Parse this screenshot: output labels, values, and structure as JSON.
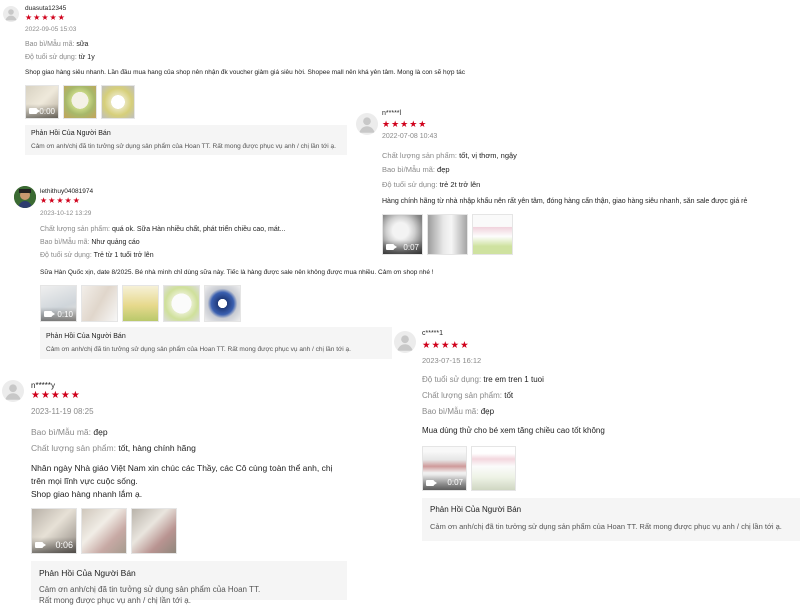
{
  "reviews": [
    {
      "username": "duasuta12345",
      "stars": "★★★★★",
      "date": "2022-09-05 15:03",
      "attrs": [
        {
          "label": "Bao bì/Mẫu mã:",
          "value": "sữa"
        },
        {
          "label": "Độ tuổi sử dụng:",
          "value": "từ 1y"
        }
      ],
      "content": "Shop giao hàng siêu nhanh. Lần đầu mua hang của shop nên nhận đk voucher giảm giá siêu hời. Shopee mall nên khá yên tâm. Mong là con sẽ hợp tác",
      "media": [
        {
          "duration": "0:00"
        },
        {},
        {}
      ],
      "reply_title": "Phản Hồi Của Người Bán",
      "reply_text": "Cảm ơn anh/chị đã tin tưởng sử dụng sản phẩm của Hoan TT. Rất mong được phục vụ anh / chị lần tới ạ."
    },
    {
      "username": "n*****l",
      "stars": "★★★★★",
      "date": "2022-07-08 10:43",
      "attrs": [
        {
          "label": "Chất lượng sản phẩm:",
          "value": "tốt, vị thơm, ngậy"
        },
        {
          "label": "Bao bì/Mẫu mã:",
          "value": "đẹp"
        },
        {
          "label": "Độ tuổi sử dụng:",
          "value": "trẻ 2t trở lên"
        }
      ],
      "content": "Hàng chính hãng từ nhà nhập khẩu nên rất yên tâm, đóng hàng cẩn thận, giao hàng siêu nhanh, săn sale được giá rẻ",
      "media": [
        {
          "duration": "0:07"
        },
        {},
        {}
      ]
    },
    {
      "username": "lethithuy04081974",
      "stars": "★★★★★",
      "date": "2023-10-12 13:29",
      "attrs": [
        {
          "label": "Chất lượng sản phẩm:",
          "value": "quá ok. Sữa Hàn nhiều chất, phát triển chiều cao, mát..."
        },
        {
          "label": "Bao bì/Mẫu mã:",
          "value": "Như quảng cáo"
        },
        {
          "label": "Độ tuổi sử dụng:",
          "value": "Trẻ từ 1 tuổi trở lên"
        }
      ],
      "content": "Sữa Hàn Quốc xịn, date 8/2025. Bé nhà mình chỉ dùng sữa này. Tiếc là hàng được sale nên không được mua nhiều. Cảm ơn shop nhé !",
      "media": [
        {
          "duration": "0:10"
        },
        {},
        {},
        {},
        {}
      ],
      "reply_title": "Phản Hồi Của Người Bán",
      "reply_text": "Cảm ơn anh/chị đã tin tưởng sử dụng sản phẩm của Hoan TT. Rất mong được phục vụ anh / chị lần tới ạ."
    },
    {
      "username": "c*****1",
      "stars": "★★★★★",
      "date": "2023-07-15 16:12",
      "attrs": [
        {
          "label": "Độ tuổi sử dụng:",
          "value": "tre em tren 1 tuoi"
        },
        {
          "label": "Chất lượng sản phẩm:",
          "value": "tốt"
        },
        {
          "label": "Bao bì/Mẫu mã:",
          "value": "đẹp"
        }
      ],
      "content": "Mua dùng thử cho bé xem tăng chiều cao tốt không",
      "media": [
        {
          "duration": "0:07"
        },
        {}
      ],
      "reply_title": "Phản Hồi Của Người Bán",
      "reply_text": "Cảm ơn anh/chị đã tin tưởng sử dụng sản phẩm của Hoan TT. Rất mong được phục vụ anh / chị lần tới ạ."
    },
    {
      "username": "n*****y",
      "stars": "★★★★★",
      "date": "2023-11-19 08:25",
      "attrs": [
        {
          "label": "Bao bì/Mẫu mã:",
          "value": "đẹp"
        },
        {
          "label": "Chất lượng sản phẩm:",
          "value": "tốt, hàng chính hãng"
        }
      ],
      "content_lines": [
        "Nhân ngày Nhà giáo Việt Nam xin chúc các Thầy, các Cô cùng toàn thể anh, chị",
        "trên mọi lĩnh vực cuộc sống.",
        "Shop giao hàng nhanh lắm ạ."
      ],
      "media": [
        {
          "duration": "0:06"
        },
        {},
        {}
      ],
      "reply_title": "Phản Hồi Của Người Bán",
      "reply_text_lines": [
        "Cảm ơn anh/chị đã tin tưởng sử dụng sản phẩm của Hoan TT.",
        "Rất mong được phục vụ anh / chị lần tới ạ."
      ]
    }
  ],
  "colors": {
    "star": "#d0011b",
    "muted": "#8a8a8a",
    "reply_bg": "#f5f5f5"
  }
}
